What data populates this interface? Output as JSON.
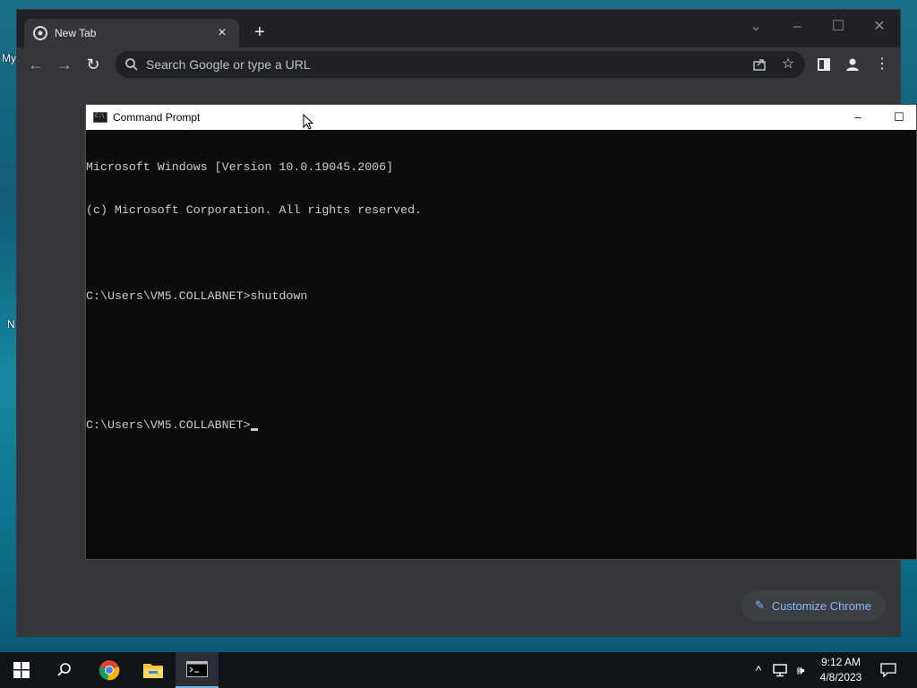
{
  "desktop": {
    "edge_labels": [
      "My",
      "N"
    ]
  },
  "chrome": {
    "tab_title": "New Tab",
    "new_tab_symbol": "+",
    "omnibox_placeholder": "Search Google or type a URL",
    "customize_label": "Customize Chrome",
    "accent": "#8ab4f8"
  },
  "cmd": {
    "title": "Command Prompt",
    "lines": [
      "Microsoft Windows [Version 10.0.19045.2006]",
      "(c) Microsoft Corporation. All rights reserved.",
      "",
      "C:\\Users\\VM5.COLLABNET>shutdown",
      "",
      "",
      "C:\\Users\\VM5.COLLABNET>"
    ]
  },
  "taskbar": {
    "time": "9:12 AM",
    "date": "4/8/2023",
    "pinned": [
      "windows-start-icon",
      "search-icon",
      "chrome-icon",
      "file-explorer-icon",
      "command-prompt-icon"
    ]
  }
}
